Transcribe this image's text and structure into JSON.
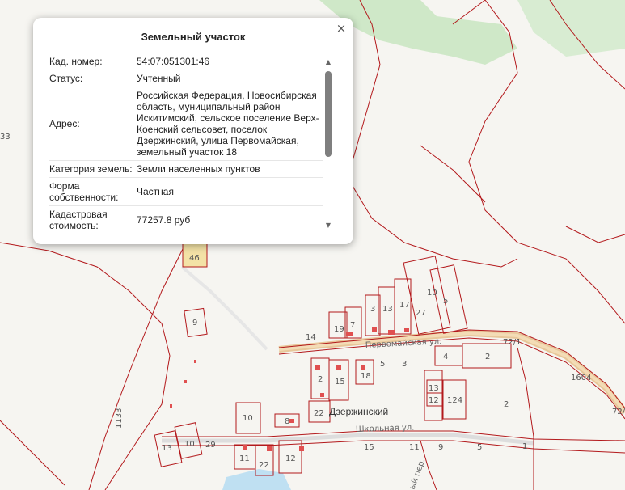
{
  "popup": {
    "title": "Земельный участок",
    "close": "×",
    "rows": [
      {
        "key": "Кад. номер:",
        "value": "54:07:051301:46"
      },
      {
        "key": "Статус:",
        "value": "Учтенный"
      },
      {
        "key": "Адрес:",
        "value": "Российская Федерация, Новосибирская область, муниципальный район Искитимский, сельское поселение Верх-Коенский сельсовет, поселок Дзержинский, улица Первомайская, земельный участок 18"
      },
      {
        "key": "Категория земель:",
        "value": "Земли населенных пунктов"
      },
      {
        "key": "Форма собственности:",
        "value": "Частная"
      },
      {
        "key": "Кадастровая стоимость:",
        "value": "77257.8 руб"
      }
    ],
    "scroll_up": "▲",
    "scroll_down": "▼"
  },
  "map": {
    "village_name": "Дзержинский",
    "streets": {
      "first": "Первомайская ул.",
      "second": "Школьная ул.",
      "lane": "ый пер."
    },
    "parcel_labels": [
      "46",
      "9",
      "14",
      "19",
      "7",
      "3",
      "13",
      "17",
      "27",
      "10",
      "5",
      "72/1",
      "4",
      "2",
      "2",
      "15",
      "18",
      "5",
      "3",
      "13",
      "12",
      "124",
      "1604",
      "2",
      "72/1",
      "22",
      "8",
      "10",
      "13",
      "10",
      "29",
      "11",
      "22",
      "12",
      "15",
      "11",
      "9",
      "5",
      "1",
      "1133",
      "33"
    ],
    "colors": {
      "boundary": "#b3191c",
      "road": "#e8c79a",
      "forest": "#cfe8c8",
      "building": "#e05050",
      "water": "#bfe0f2",
      "background": "#f6f5f1"
    }
  }
}
